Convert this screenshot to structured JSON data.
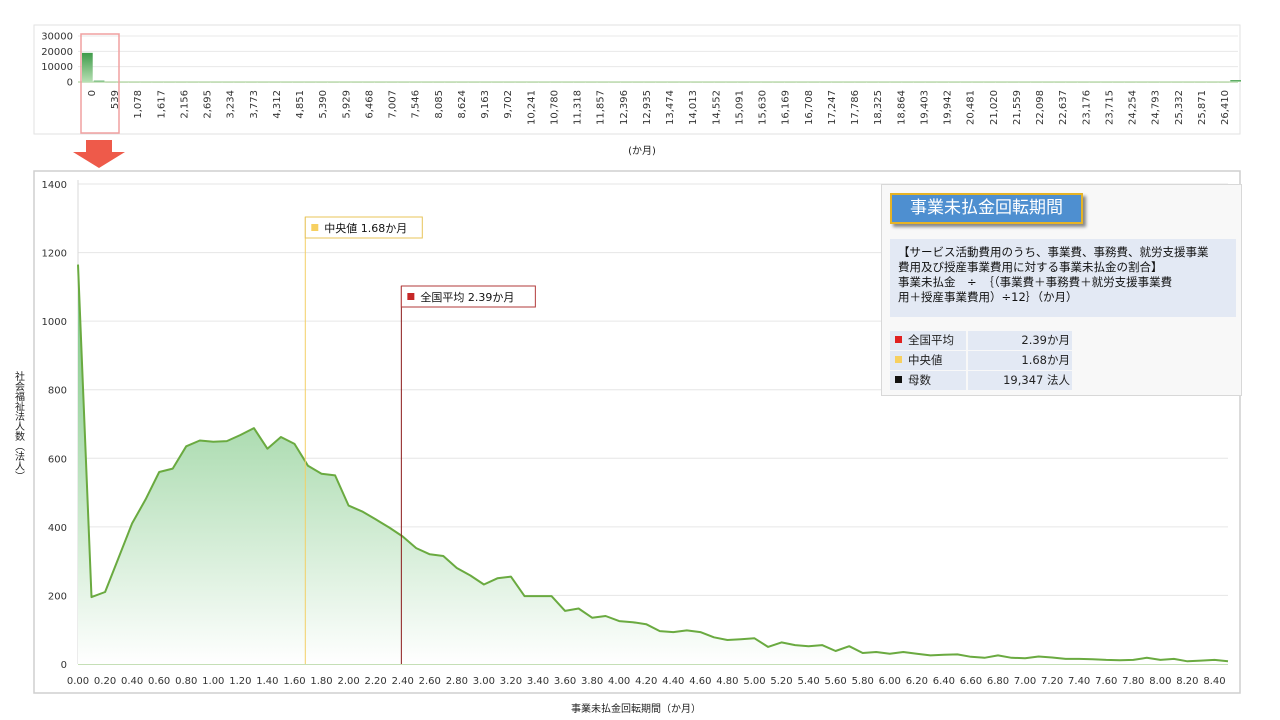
{
  "overview": {
    "y_ticks": [
      "30000",
      "20000",
      "10000",
      "0"
    ],
    "y_range": [
      0,
      30000
    ],
    "x_ticks": [
      "0",
      "539",
      "1,078",
      "1,617",
      "2,156",
      "2,695",
      "3,234",
      "3,773",
      "4,312",
      "4,851",
      "5,390",
      "5,929",
      "6,468",
      "7,007",
      "7,546",
      "8,085",
      "8,624",
      "9,163",
      "9,702",
      "10,241",
      "10,780",
      "11,318",
      "11,857",
      "12,396",
      "12,935",
      "13,474",
      "14,013",
      "14,552",
      "15,091",
      "15,630",
      "16,169",
      "16,708",
      "17,247",
      "17,786",
      "18,325",
      "18,864",
      "19,403",
      "19,942",
      "20,481",
      "21,020",
      "21,559",
      "22,098",
      "22,637",
      "23,176",
      "23,715",
      "24,254",
      "24,793",
      "25,332",
      "25,871",
      "26,410"
    ],
    "bars": [
      19000,
      900,
      0,
      0,
      0,
      0,
      0,
      0,
      0,
      0,
      0,
      0,
      0,
      0,
      0,
      0,
      0,
      0,
      0,
      0,
      0,
      0,
      0,
      0,
      0,
      0,
      0,
      0,
      0,
      0,
      0,
      0,
      0,
      0,
      0,
      0,
      0,
      0,
      0,
      0,
      0,
      0,
      0,
      0,
      0,
      0,
      0,
      0,
      0,
      0,
      0,
      0,
      0,
      0,
      0,
      0,
      0,
      0,
      0,
      0,
      0,
      0,
      0,
      0,
      0,
      0,
      0,
      0,
      0,
      0,
      0,
      0,
      0,
      0,
      0,
      0,
      0,
      0,
      0,
      0,
      0,
      0,
      0,
      0,
      0,
      0,
      0,
      0,
      0,
      0,
      0,
      0,
      0,
      0,
      0,
      0,
      0,
      0,
      1300
    ],
    "xlabel": "(か月)"
  },
  "chart_data": {
    "type": "area",
    "xlabel": "事業未払金回転期間（か月）",
    "ylabel": "社会福祉法人数（法人）",
    "xlim": [
      0,
      8.5
    ],
    "ylim": [
      0,
      1400
    ],
    "y_ticks": [
      0,
      200,
      400,
      600,
      800,
      1000,
      1200,
      1400
    ],
    "x_ticks": [
      "0.00",
      "0.20",
      "0.40",
      "0.60",
      "0.80",
      "1.00",
      "1.20",
      "1.40",
      "1.60",
      "1.80",
      "2.00",
      "2.20",
      "2.40",
      "2.60",
      "2.80",
      "3.00",
      "3.20",
      "3.40",
      "3.60",
      "3.80",
      "4.00",
      "4.20",
      "4.40",
      "4.60",
      "4.80",
      "5.00",
      "5.20",
      "5.40",
      "5.60",
      "5.80",
      "6.00",
      "6.20",
      "6.40",
      "6.60",
      "6.80",
      "7.00",
      "7.20",
      "7.40",
      "7.60",
      "7.80",
      "8.00",
      "8.20",
      "8.40"
    ],
    "x": [
      0.0,
      0.1,
      0.2,
      0.3,
      0.4,
      0.5,
      0.6,
      0.7,
      0.8,
      0.9,
      1.0,
      1.1,
      1.2,
      1.3,
      1.4,
      1.5,
      1.6,
      1.7,
      1.8,
      1.9,
      2.0,
      2.1,
      2.2,
      2.3,
      2.4,
      2.5,
      2.6,
      2.7,
      2.8,
      2.9,
      3.0,
      3.1,
      3.2,
      3.3,
      3.4,
      3.5,
      3.6,
      3.7,
      3.8,
      3.9,
      4.0,
      4.1,
      4.2,
      4.3,
      4.4,
      4.5,
      4.6,
      4.7,
      4.8,
      4.9,
      5.0,
      5.1,
      5.2,
      5.3,
      5.4,
      5.5,
      5.6,
      5.7,
      5.8,
      5.9,
      6.0,
      6.1,
      6.2,
      6.3,
      6.4,
      6.5,
      6.6,
      6.7,
      6.8,
      6.9,
      7.0,
      7.1,
      7.2,
      7.3,
      7.4,
      7.5,
      7.6,
      7.7,
      7.8,
      7.9,
      8.0,
      8.1,
      8.2,
      8.3,
      8.4,
      8.5
    ],
    "values": [
      1165,
      195,
      210,
      310,
      410,
      480,
      560,
      570,
      635,
      652,
      648,
      650,
      668,
      688,
      628,
      662,
      642,
      578,
      555,
      550,
      462,
      445,
      422,
      398,
      372,
      338,
      320,
      315,
      280,
      258,
      232,
      250,
      255,
      198,
      198,
      198,
      155,
      162,
      135,
      140,
      125,
      122,
      116,
      96,
      93,
      98,
      93,
      78,
      70,
      72,
      75,
      50,
      63,
      55,
      52,
      55,
      38,
      52,
      32,
      35,
      30,
      35,
      30,
      25,
      27,
      28,
      21,
      18,
      25,
      18,
      17,
      22,
      19,
      15,
      15,
      14,
      12,
      11,
      12,
      18,
      12,
      15,
      8,
      10,
      12,
      8
    ],
    "reference_lines": [
      {
        "name": "中央値",
        "value": 1.68,
        "label": "中央値  1.68か月",
        "color": "#f7d060"
      },
      {
        "name": "全国平均",
        "value": 2.39,
        "label": "全国平均    2.39か月",
        "color": "#c62828"
      }
    ]
  },
  "info_panel": {
    "title": "事業未払金回転期間",
    "description_lines": [
      "【サービス活動費用のうち、事業費、事務費、就労支援事業",
      "費用及び授産事業費用に対する事業未払金の割合】",
      "事業未払金　÷　｛（事業費＋事務費＋就労支援事業費",
      "用＋授産事業費用）÷12｝（か月）"
    ],
    "stats": [
      {
        "label": "全国平均",
        "value": "2.39か月",
        "color": "#e02020"
      },
      {
        "label": "中央値",
        "value": "1.68か月",
        "color": "#f7d060"
      },
      {
        "label": "母数",
        "value": "19,347  法人",
        "color": "#111111"
      }
    ]
  },
  "colors": {
    "line": "#6aaa40",
    "fill_top": "#7fcb84",
    "fill_bottom": "#ffffff",
    "highlight_box": "#f0a0a0",
    "arrow": "#ee5a4a"
  }
}
